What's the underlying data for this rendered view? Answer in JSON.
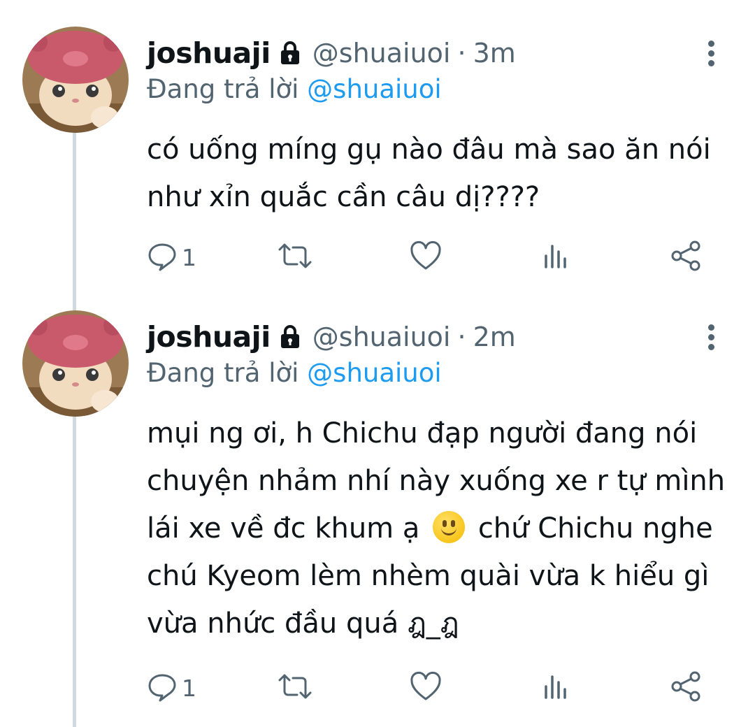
{
  "tweets": [
    {
      "display_name": "joshuaji",
      "handle": "@shuaiuoi",
      "separator": "·",
      "time": "3m",
      "replying_prefix": "Đang trả lời",
      "replying_to": "@shuaiuoi",
      "text_lines": [
        "có uống míng gụ nào đâu mà sao ăn nói",
        "như xỉn quắc cần câu dị????"
      ],
      "reply_count": "1"
    },
    {
      "display_name": "joshuaji",
      "handle": "@shuaiuoi",
      "separator": "·",
      "time": "2m",
      "replying_prefix": "Đang trả lời",
      "replying_to": "@shuaiuoi",
      "text_lines": [
        "mụi ng ơi, h Chichu đạp người đang nói",
        "chuyện nhảm nhí này xuống xe r tự mình",
        "lái xe về đc khum ạ",
        "chứ Chichu nghe",
        "chú Kyeom lèm nhèm quài vừa k hiểu gì",
        "vừa nhức đầu quá ฎ_ฎ"
      ],
      "emoji": "slightly-smiling-face",
      "reply_count": "1"
    }
  ],
  "icons": {
    "lock": "lock-icon",
    "more": "more-vertical-icon",
    "reply": "reply-icon",
    "retweet": "retweet-icon",
    "like": "heart-icon",
    "analytics": "analytics-icon",
    "share": "share-icon"
  },
  "colors": {
    "text_primary": "#0f1419",
    "text_secondary": "#536471",
    "link": "#1d9bf0",
    "thread_line": "#cfd9de"
  }
}
